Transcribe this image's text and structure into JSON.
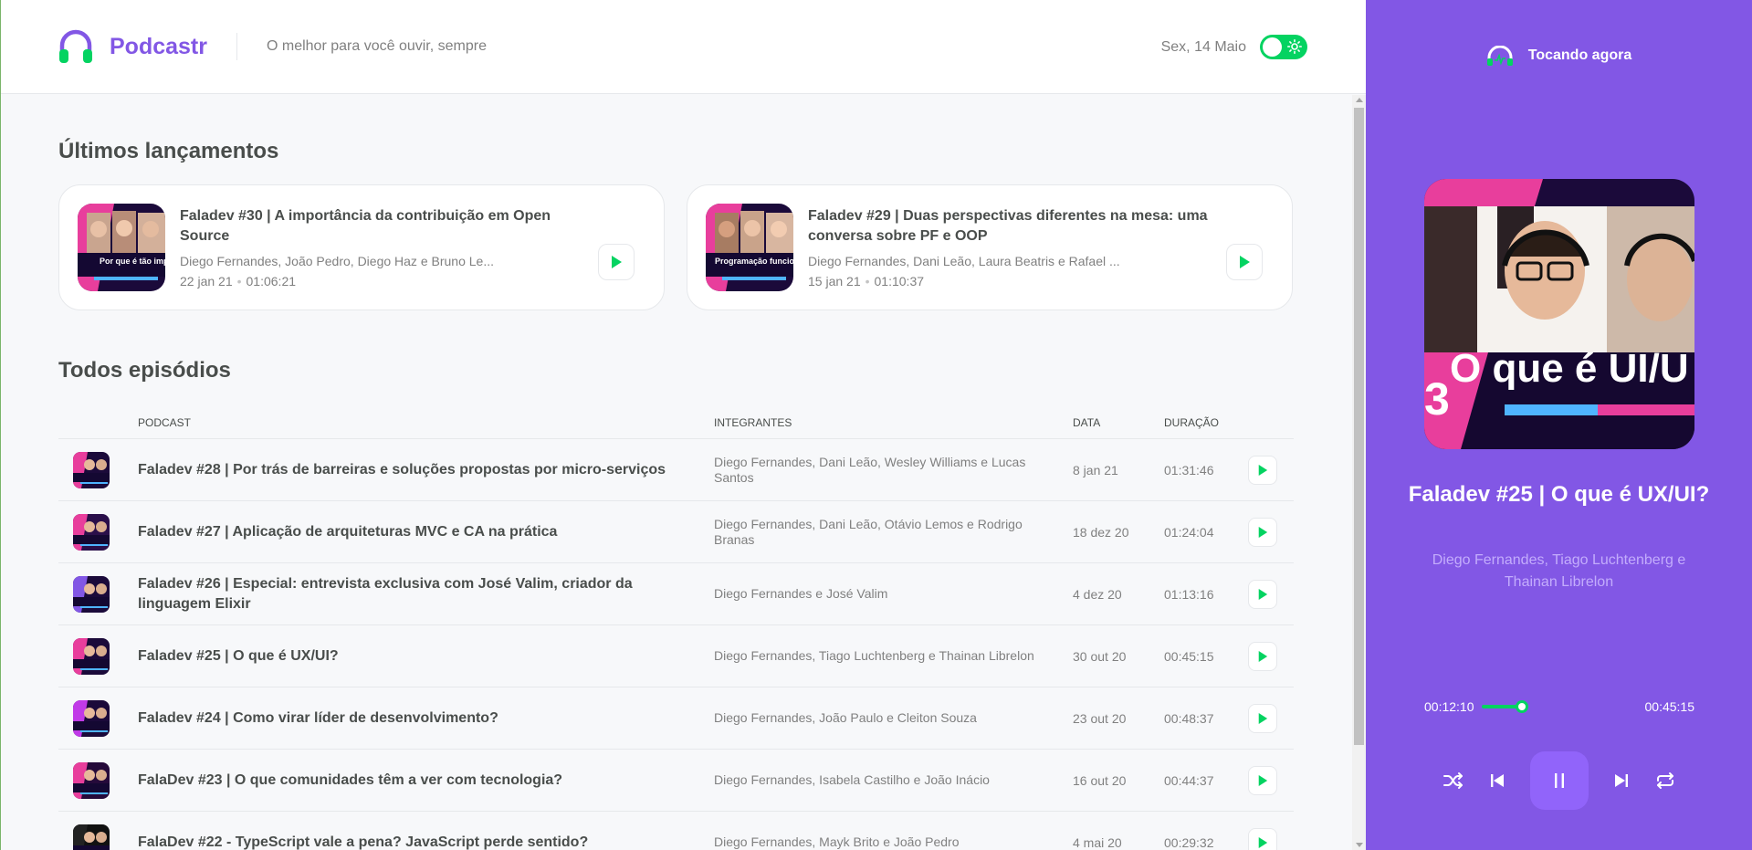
{
  "header": {
    "app_name": "Podcastr",
    "tagline": "O melhor para você ouvir, sempre",
    "date": "Sex, 14 Maio",
    "theme_toggle_on": true
  },
  "latest": {
    "title": "Últimos lançamentos",
    "items": [
      {
        "title": "Faladev #30 | A importância da contribuição em Open Source",
        "members": "Diego Fernandes, João Pedro, Diego Haz e Bruno Le...",
        "date": "22 jan 21",
        "duration": "01:06:21",
        "thumb_caption": "Por que é tão imp contribuir em Open S"
      },
      {
        "title": "Faladev #29 | Duas perspectivas diferentes na mesa: uma conversa sobre PF e OOP",
        "members": "Diego Fernandes, Dani Leão, Laura Beatris e Rafael ...",
        "date": "15 jan 21",
        "duration": "01:10:37",
        "thumb_caption": "Programação funcion devs orientados a o"
      }
    ]
  },
  "all": {
    "title": "Todos episódios",
    "columns": {
      "podcast": "Podcast",
      "members": "Integrantes",
      "date": "Data",
      "duration": "Duração"
    },
    "rows": [
      {
        "title": "Faladev #28 | Por trás de barreiras e soluções propostas por micro-serviços",
        "members": "Diego Fernandes, Dani Leão, Wesley Williams e Lucas Santos",
        "date": "8 jan 21",
        "duration": "01:31:46"
      },
      {
        "title": "Faladev #27 | Aplicação de arquiteturas MVC e CA na prática",
        "members": "Diego Fernandes, Dani Leão, Otávio Lemos e Rodrigo Branas",
        "date": "18 dez 20",
        "duration": "01:24:04"
      },
      {
        "title": "Faladev #26 | Especial: entrevista exclusiva com José Valim, criador da linguagem Elixir",
        "members": "Diego Fernandes e José Valim",
        "date": "4 dez 20",
        "duration": "01:13:16"
      },
      {
        "title": "Faladev #25 | O que é UX/UI?",
        "members": "Diego Fernandes, Tiago Luchtenberg e Thainan Librelon",
        "date": "30 out 20",
        "duration": "00:45:15"
      },
      {
        "title": "Faladev #24 | Como virar líder de desenvolvimento?",
        "members": "Diego Fernandes, João Paulo e Cleiton Souza",
        "date": "23 out 20",
        "duration": "00:48:37"
      },
      {
        "title": "FalaDev #23 | O que comunidades têm a ver com tecnologia?",
        "members": "Diego Fernandes, Isabela Castilho e João Inácio",
        "date": "16 out 20",
        "duration": "00:44:37"
      },
      {
        "title": "FalaDev #22 - TypeScript vale a pena? JavaScript perde sentido?",
        "members": "Diego Fernandes, Mayk Brito e João Pedro",
        "date": "4 mai 20",
        "duration": "00:29:32"
      }
    ]
  },
  "player": {
    "header": "Tocando agora",
    "title": "Faladev #25 | O que é UX/UI?",
    "members": "Diego Fernandes, Tiago Luchtenberg e Thainan Librelon",
    "cover_caption": "O que é UI/U",
    "cover_number": "3",
    "current_time": "00:12:10",
    "total_time": "00:45:15",
    "progress_fraction": 0.269,
    "is_playing": true
  },
  "colors": {
    "brand": "#8257e5",
    "accent_green": "#04d361",
    "cover_pink": "#e83e9c",
    "cover_dark": "#1b0a3a"
  }
}
